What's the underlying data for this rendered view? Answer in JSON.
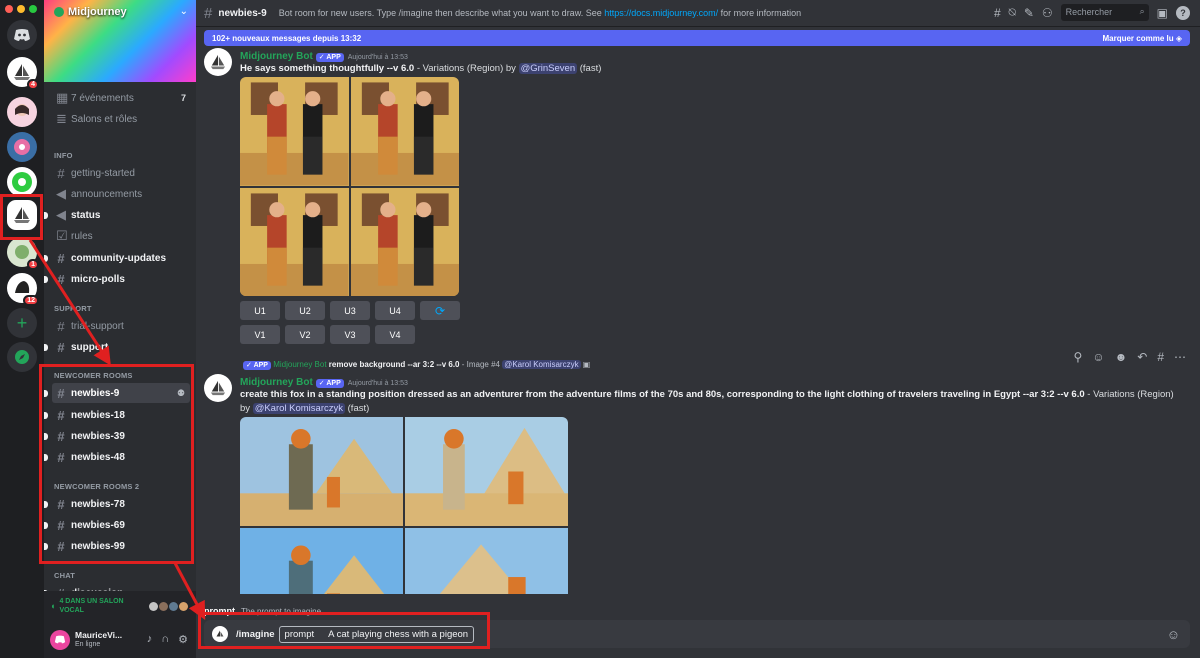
{
  "server": {
    "name": "Midjourney"
  },
  "guild_badges": [
    "4",
    "1",
    "12"
  ],
  "channel_list": {
    "events": {
      "label": "7 événements",
      "count": "7"
    },
    "salons": "Salons et rôles",
    "categories": {
      "info": "INFO",
      "support": "SUPPORT",
      "newcomer": "NEWCOMER ROOMS",
      "newcomer2": "NEWCOMER ROOMS 2",
      "chat": "CHAT"
    },
    "info_channels": [
      "getting-started",
      "announcements",
      "status",
      "rules",
      "community-updates",
      "micro-polls"
    ],
    "support_channels": [
      "trial-support",
      "support"
    ],
    "newcomer_channels": [
      "newbies-9",
      "newbies-18",
      "newbies-39",
      "newbies-48"
    ],
    "newcomer2_channels": [
      "newbies-78",
      "newbies-69",
      "newbies-99"
    ],
    "chat_channels": [
      "discussion"
    ]
  },
  "voice_status": {
    "line1": "4 DANS UN SALON",
    "line2": "VOCAL"
  },
  "user": {
    "name": "MauriceVi...",
    "status": "En ligne"
  },
  "header": {
    "channel": "newbies-9",
    "topic_pre": "Bot room for new users. Type /imagine then describe what you want to draw. See ",
    "topic_link": "https://docs.midjourney.com/",
    "topic_post": " for more information",
    "search_placeholder": "Rechercher"
  },
  "new_messages": {
    "label": "102+ nouveaux messages depuis 13:32",
    "mark": "Marquer comme lu"
  },
  "message1": {
    "author": "Midjourney Bot",
    "tag": "APP",
    "time": "Aujourd'hui à 13:53",
    "prompt": "He says something thoughtfully --v 6.0",
    "suffix": " - Variations (Region) by ",
    "mention": "@GrinSeven",
    "mode": " (fast)",
    "buttons_u": [
      "U1",
      "U2",
      "U3",
      "U4"
    ],
    "buttons_v": [
      "V1",
      "V2",
      "V3",
      "V4"
    ]
  },
  "reply": {
    "tag": "APP",
    "author": "Midjourney Bot",
    "text": "remove background --ar 3:2 --v 6.0",
    "suffix": " - Image #4 ",
    "mention": "@Karol Komisarczyk"
  },
  "message2": {
    "author": "Midjourney Bot",
    "tag": "APP",
    "time": "Aujourd'hui à 13:53",
    "prompt": "create this fox in a standing position dressed as an adventurer from the adventure films of the 70s and 80s, corresponding to the light clothing of travelers traveling in Egypt --ar 3:2 --v 6.0",
    "suffix": " - Variations (Region)",
    "by": "by ",
    "mention": "@Karol Komisarczyk",
    "mode": " (fast)"
  },
  "command_hint": {
    "name": "prompt",
    "desc": "The prompt to imagine"
  },
  "composer": {
    "command": "/imagine",
    "option": "prompt",
    "value": "A cat playing chess with a pigeon"
  },
  "colors": {
    "blurple": "#5865f2",
    "green": "#23a55a",
    "annotation_red": "#e02020"
  }
}
